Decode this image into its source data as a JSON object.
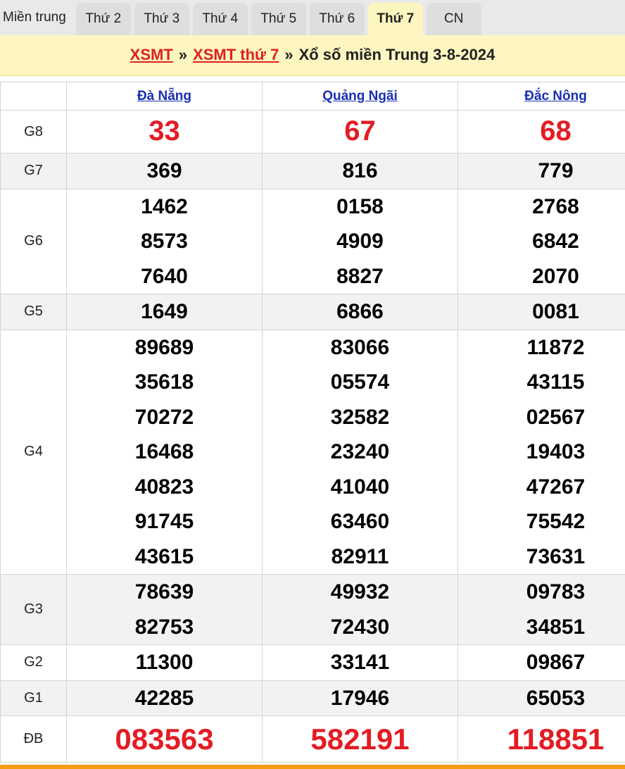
{
  "tabs": {
    "region": "Miền trung",
    "days": [
      "Thứ 2",
      "Thứ 3",
      "Thứ 4",
      "Thứ 5",
      "Thứ 6",
      "Thứ 7",
      "CN"
    ],
    "active_index": 5
  },
  "title": {
    "link1": "XSMT",
    "sep1": "»",
    "link2": "XSMT thứ 7",
    "sep2": "»",
    "text": "Xổ số miền Trung 3-8-2024"
  },
  "provinces": [
    "Đà Nẵng",
    "Quảng Ngãi",
    "Đắc Nông"
  ],
  "prizes": [
    {
      "label": "G8",
      "values": [
        [
          "33"
        ],
        [
          "67"
        ],
        [
          "68"
        ]
      ]
    },
    {
      "label": "G7",
      "values": [
        [
          "369"
        ],
        [
          "816"
        ],
        [
          "779"
        ]
      ]
    },
    {
      "label": "G6",
      "values": [
        [
          "1462",
          "8573",
          "7640"
        ],
        [
          "0158",
          "4909",
          "8827"
        ],
        [
          "2768",
          "6842",
          "2070"
        ]
      ]
    },
    {
      "label": "G5",
      "values": [
        [
          "1649"
        ],
        [
          "6866"
        ],
        [
          "0081"
        ]
      ]
    },
    {
      "label": "G4",
      "values": [
        [
          "89689",
          "35618",
          "70272",
          "16468",
          "40823",
          "91745",
          "43615"
        ],
        [
          "83066",
          "05574",
          "32582",
          "23240",
          "41040",
          "63460",
          "82911"
        ],
        [
          "11872",
          "43115",
          "02567",
          "19403",
          "47267",
          "75542",
          "73631"
        ]
      ]
    },
    {
      "label": "G3",
      "values": [
        [
          "78639",
          "82753"
        ],
        [
          "49932",
          "72430"
        ],
        [
          "09783",
          "34851"
        ]
      ]
    },
    {
      "label": "G2",
      "values": [
        [
          "11300"
        ],
        [
          "33141"
        ],
        [
          "09867"
        ]
      ]
    },
    {
      "label": "G1",
      "values": [
        [
          "42285"
        ],
        [
          "17946"
        ],
        [
          "65053"
        ]
      ]
    },
    {
      "label": "ĐB",
      "values": [
        [
          "083563"
        ],
        [
          "582191"
        ],
        [
          "118851"
        ]
      ]
    }
  ],
  "colors": {
    "accent_red": "#e31c24",
    "link_blue": "#1a2fb0",
    "banner_yellow": "#fdf6c0",
    "bottom_orange": "#f39c12"
  }
}
